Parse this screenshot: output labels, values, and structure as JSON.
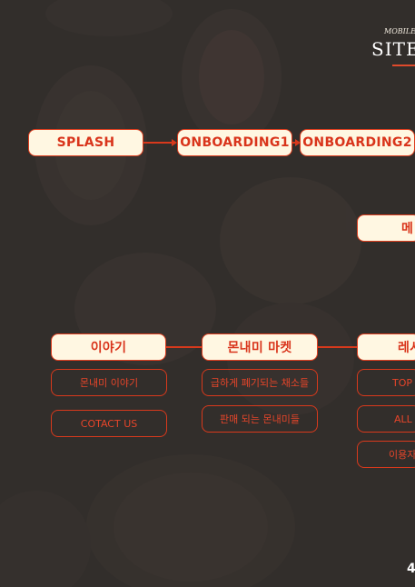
{
  "header": {
    "subtitle": "MOBILE",
    "title": "SITE"
  },
  "flow": {
    "top_row": [
      "SPLASH",
      "ONBOARDING1",
      "ONBOARDING2"
    ],
    "right_box": "메",
    "mid_row": [
      "이야기",
      "몬내미 마켓",
      "레시"
    ],
    "story_items": [
      "몬내미 이야기",
      "COTACT US"
    ],
    "market_items": [
      "급하게 폐기되는 채소들",
      "판매 되는 몬내미들"
    ],
    "recipe_items": [
      "TOP",
      "ALL",
      "이용자"
    ]
  },
  "page_number": "4",
  "colors": {
    "background": "#322e2b",
    "box_fill": "#fff7e2",
    "accent_red": "#d8391c"
  }
}
